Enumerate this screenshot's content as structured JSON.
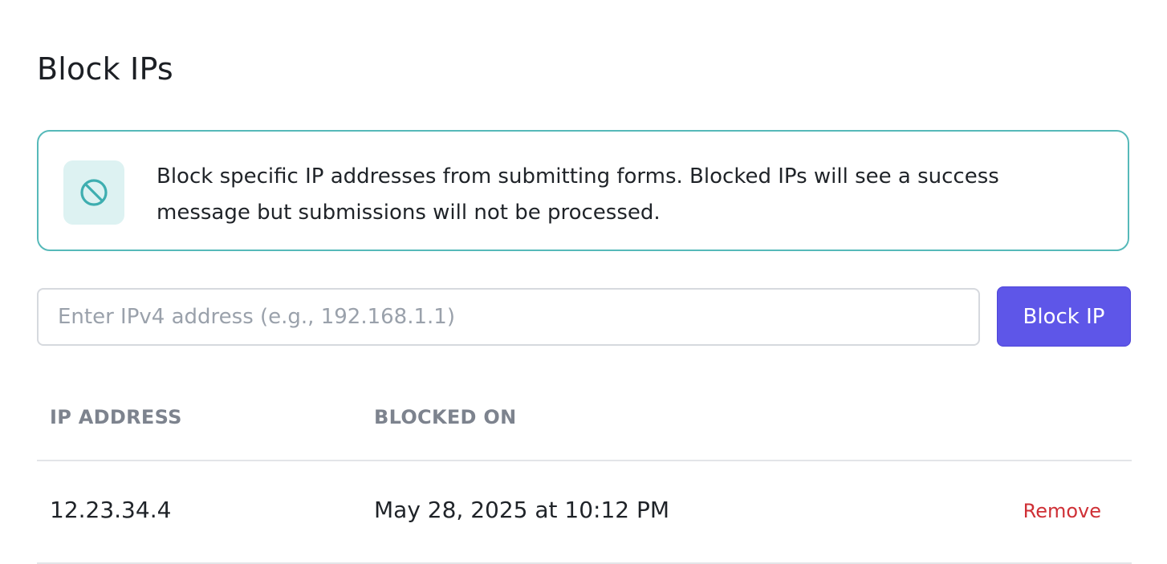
{
  "page": {
    "title": "Block IPs"
  },
  "info": {
    "icon": "block-icon",
    "text": "Block specific IP addresses from submitting forms. Blocked IPs will see a success message but submissions will not be processed.",
    "border_color": "#56b9b9",
    "icon_bg": "#ddf2f2"
  },
  "form": {
    "input_value": "",
    "input_placeholder": "Enter IPv4 address (e.g., 192.168.1.1)",
    "button_label": "Block IP",
    "button_color": "#5e56e8"
  },
  "table": {
    "columns": [
      "IP ADDRESS",
      "BLOCKED ON"
    ],
    "rows": [
      {
        "ip": "12.23.34.4",
        "blocked_on": "May 28, 2025 at 10:12 PM",
        "action": "Remove"
      }
    ],
    "action_color": "#cf3036"
  }
}
